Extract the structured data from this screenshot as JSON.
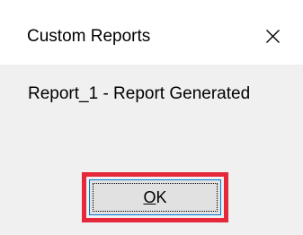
{
  "dialog": {
    "title": "Custom Reports",
    "message": "Report_1 - Report Generated",
    "ok_mnemonic": "O",
    "ok_rest": "K"
  },
  "icons": {
    "close": "close-icon"
  },
  "colors": {
    "titlebar_bg": "#ffffff",
    "body_bg": "#f0f0f0",
    "button_bg": "#e1e1e1",
    "button_border": "#0078d7",
    "highlight": "#e5283a"
  }
}
